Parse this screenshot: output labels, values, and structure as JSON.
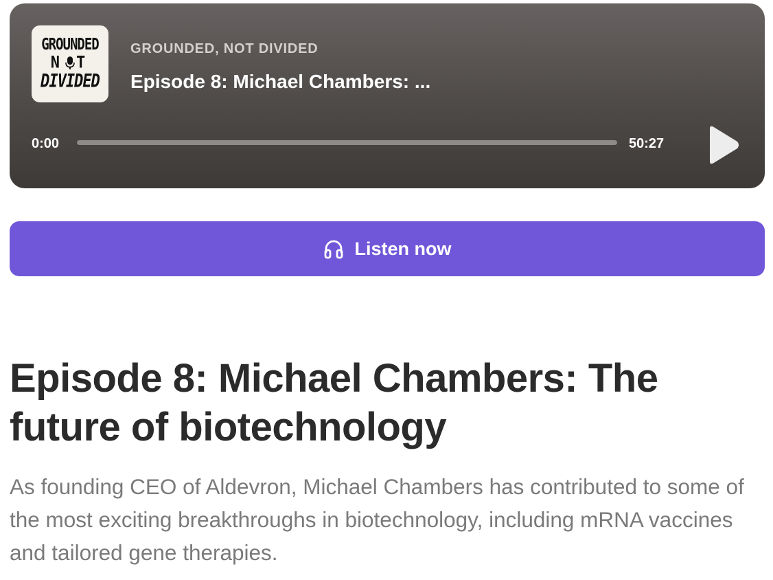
{
  "player": {
    "cover_art": {
      "line1": "GROUNDED",
      "line2_left": "N",
      "line2_right": "T",
      "line3": "DIVIDED"
    },
    "show_name": "GROUNDED, NOT DIVIDED",
    "episode_title": "Episode 8: Michael Chambers: ...",
    "current_time": "0:00",
    "duration": "50:27",
    "progress": 0,
    "play_icon": "play-icon"
  },
  "listen_button": {
    "label": "Listen now",
    "icon": "headphones-icon",
    "color": "#7057d9"
  },
  "article": {
    "title": "Episode 8: Michael Chambers: The future of biotechnology",
    "description": "As founding CEO of Aldevron, Michael Chambers has contributed to some of the most exciting breakthroughs in biotechnology, including mRNA vaccines and tailored gene therapies."
  }
}
